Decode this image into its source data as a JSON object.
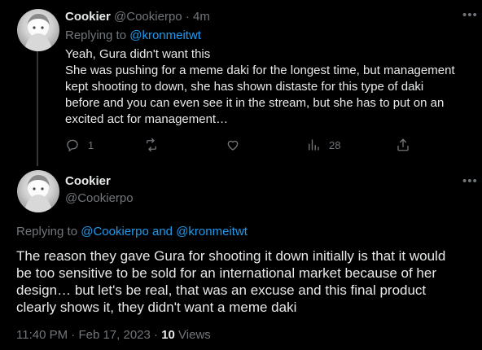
{
  "tweet1": {
    "display_name": "Cookier",
    "handle": "@Cookierpo",
    "separator": "·",
    "time": "4m",
    "replying_prefix": "Replying to",
    "replying_to": "@kronmeitwt",
    "text_lines": [
      "Yeah, Gura didn't want this",
      "She was pushing for a meme daki for the longest time, but management",
      "kept shooting to down, she has shown distaste for this type of daki",
      "before and you can even see it in the stream, but she has to put on an",
      "excited act for management…"
    ],
    "actions": {
      "reply_count": "1",
      "retweet_count": "",
      "like_count": "",
      "views_count": "28"
    }
  },
  "tweet2": {
    "display_name": "Cookier",
    "handle": "@Cookierpo",
    "replying_prefix": "Replying to",
    "replying_to_1": "@Cookierpo",
    "replying_and": "and",
    "replying_to_2": "@kronmeitwt",
    "text_lines": [
      "The reason they gave Gura for shooting it down initially is that it would",
      "be too sensitive to be sold for an international market because of her",
      "design… but let's be real, that was an excuse and this final product",
      "clearly shows it, they didn't want a meme daki"
    ],
    "time": "11:40 PM",
    "date": "Feb 17, 2023",
    "views_count": "10",
    "views_label": "Views"
  },
  "icons": {
    "more": "more-horizontal-icon",
    "reply": "reply-bubble-icon",
    "retweet": "retweet-icon",
    "like": "heart-icon",
    "views": "analytics-bars-icon",
    "share": "share-upload-icon"
  },
  "colors": {
    "background": "#000000",
    "text": "#e7e9ea",
    "muted": "#71767b",
    "link": "#1d9bf0",
    "divider": "#333639"
  }
}
